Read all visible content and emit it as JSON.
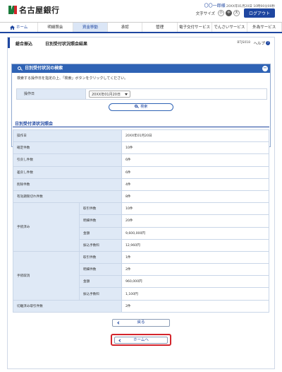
{
  "header": {
    "bank_name": "名古屋銀行",
    "user_name": "〇〇一郎様",
    "last_login": "20XX年01月20日 10時00分00秒",
    "font_size_label": "文字サイズ",
    "font_sizes": [
      "小",
      "中",
      "大"
    ],
    "active_font_size": "中",
    "logout_label": "ログアウト"
  },
  "nav": {
    "items": [
      "ホーム",
      "明細照会",
      "資金移動",
      "承認",
      "管理",
      "電子交付サービス",
      "でんさいサービス",
      "外為サービス"
    ],
    "active": "資金移動"
  },
  "page": {
    "breadcrumb": "総合振込",
    "title": "日別受付状況照会結果",
    "screen_id": "BTJS018",
    "help_label": "ヘルプ"
  },
  "search": {
    "panel_title": "日別受付状況の検索",
    "description": "検索する操作日を指定の上、「検索」ボタンをクリックしてください。",
    "date_label": "操作日",
    "date_value": "20XX年01月20日",
    "search_button": "検索"
  },
  "result": {
    "heading": "日別受付済状況照会",
    "rows": [
      {
        "label": "操作日",
        "value": "20XX年01月20日"
      },
      {
        "label": "確定件数",
        "value": "10件"
      },
      {
        "label": "引戻し件数",
        "value": "6件"
      },
      {
        "label": "差戻し件数",
        "value": "6件"
      },
      {
        "label": "削除件数",
        "value": "4件"
      },
      {
        "label": "有効期限切れ件数",
        "value": "8件"
      }
    ],
    "groups": [
      {
        "label": "手続済み",
        "rows": [
          {
            "label": "取引件数",
            "value": "10件"
          },
          {
            "label": "明細件数",
            "value": "20件"
          },
          {
            "label": "金額",
            "value": "9,600,000円"
          },
          {
            "label": "振込手数料",
            "value": "12,960円"
          }
        ]
      },
      {
        "label": "手続取消",
        "rows": [
          {
            "label": "取引件数",
            "value": "1件"
          },
          {
            "label": "明細件数",
            "value": "2件"
          },
          {
            "label": "金額",
            "value": "960,000円"
          },
          {
            "label": "振込手数料",
            "value": "1,100円"
          }
        ]
      }
    ],
    "last_row": {
      "label": "切離済み取引件数",
      "value": "2件"
    }
  },
  "buttons": {
    "back": "戻る",
    "home": "ホームへ"
  }
}
